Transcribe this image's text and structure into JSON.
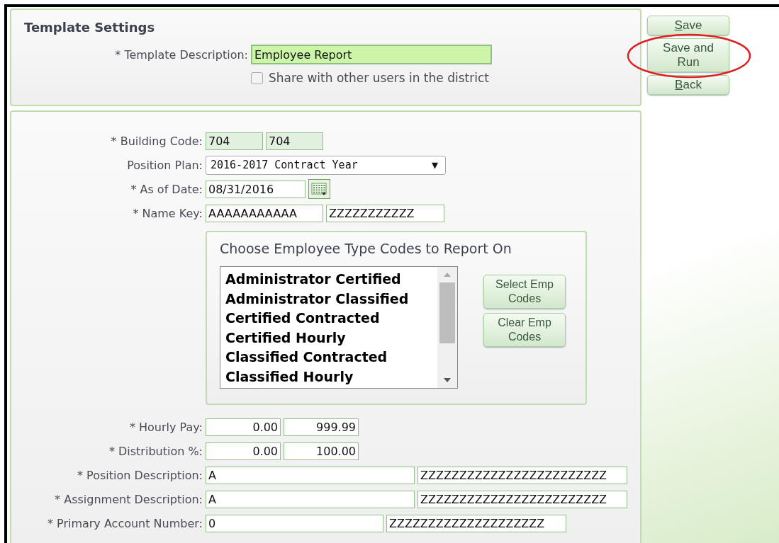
{
  "template_settings": {
    "title": "Template Settings",
    "description": {
      "label": "* Template Description:",
      "value": "Employee Report"
    },
    "share": {
      "label": "Share with other users in the district",
      "checked": false
    }
  },
  "actions": [
    {
      "label": "Save",
      "underline_first": true,
      "highlighted": false
    },
    {
      "label": "Save and Run",
      "underline_first": false,
      "highlighted": true
    },
    {
      "label": "Back",
      "underline_first": true,
      "highlighted": false
    }
  ],
  "criteria_top": [
    {
      "kind": "code",
      "label": "* Building Code:",
      "values": [
        "704",
        "704"
      ]
    },
    {
      "kind": "select",
      "label": "Position Plan:",
      "values": [
        "2016-2017 Contract Year"
      ],
      "arrow": "▼"
    },
    {
      "kind": "date",
      "label": "* As of Date:",
      "values": [
        "08/31/2016"
      ]
    },
    {
      "kind": "key",
      "label": "* Name Key:",
      "values": [
        "AAAAAAAAAAA",
        "ZZZZZZZZZZZ"
      ]
    }
  ],
  "employee_types": {
    "title": "Choose Employee Type Codes to Report On",
    "items": [
      "Administrator Certified",
      "Administrator Classified",
      "Certified Contracted",
      "Certified Hourly",
      "Classified Contracted",
      "Classified Hourly"
    ],
    "buttons": [
      "Select Emp Codes",
      "Clear Emp Codes"
    ]
  },
  "criteria_bottom": [
    {
      "kind": "amount",
      "label": "* Hourly Pay:",
      "values": [
        "0.00",
        "999.99"
      ]
    },
    {
      "kind": "amount",
      "label": "* Distribution %:",
      "values": [
        "0.00",
        "100.00"
      ]
    },
    {
      "kind": "description",
      "label": "* Position Description:",
      "values": [
        "A",
        "ZZZZZZZZZZZZZZZZZZZZZZZZ"
      ]
    },
    {
      "kind": "description",
      "label": "* Assignment Description:",
      "values": [
        "A",
        "ZZZZZZZZZZZZZZZZZZZZZZZZ"
      ]
    },
    {
      "kind": "account",
      "label": "* Primary Account Number:",
      "values": [
        "0",
        "ZZZZZZZZZZZZZZZZZZZZ"
      ]
    }
  ]
}
